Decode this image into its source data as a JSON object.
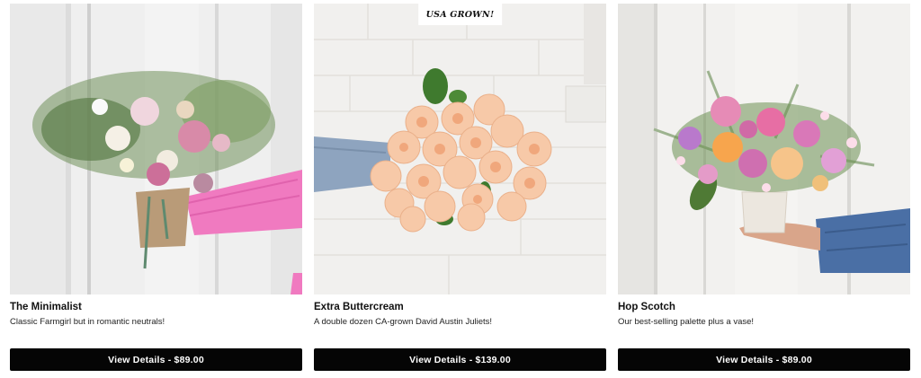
{
  "products": [
    {
      "title": "The Minimalist",
      "description": "Classic Farmgirl but in romantic neutrals!",
      "button_label": "View Details - $89.00",
      "badge": ""
    },
    {
      "title": "Extra Buttercream",
      "description": "A double dozen CA-grown David Austin Juliets!",
      "button_label": "View Details - $139.00",
      "badge": "USA GROWN!"
    },
    {
      "title": "Hop Scotch",
      "description": "Our best-selling palette plus a vase!",
      "button_label": "View Details - $89.00",
      "badge": ""
    }
  ],
  "colors": {
    "button_bg": "#050505",
    "button_text": "#ffffff",
    "accent_pink_sleeve": "#f07ac0",
    "peach_rose": "#f7c9a8",
    "denim": "#4a6fa5"
  }
}
